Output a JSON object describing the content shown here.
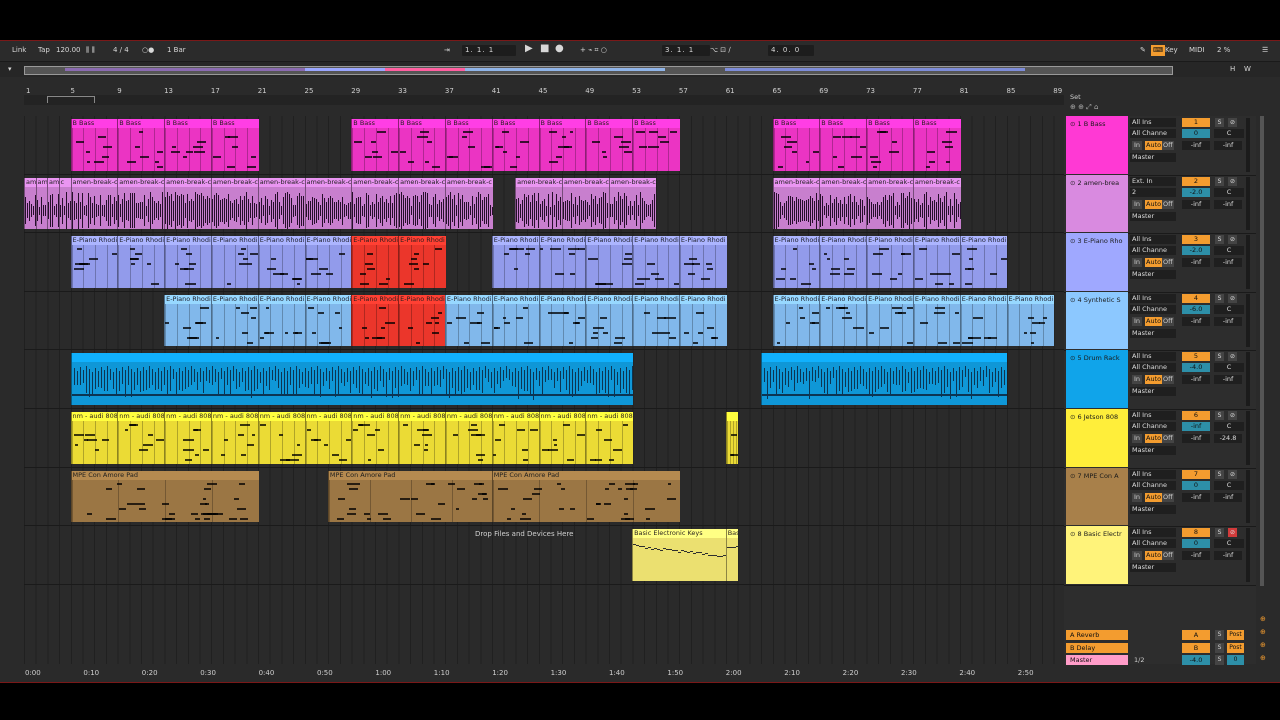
{
  "transport": {
    "link": "Link",
    "tap": "Tap",
    "tempo": "120.00",
    "signature": "4 / 4",
    "quantize": "1 Bar",
    "position": "1.  1.  1",
    "loop_start": "3.  1.  1",
    "loop_length": "4.  0.  0",
    "key": "Key",
    "midi": "MIDI",
    "cpu": "2 %"
  },
  "bar_numbers": [
    "1",
    "5",
    "9",
    "13",
    "17",
    "21",
    "25",
    "29",
    "33",
    "37",
    "41",
    "45",
    "49",
    "53",
    "57",
    "61",
    "65",
    "69",
    "73",
    "77",
    "81",
    "85",
    "89"
  ],
  "time_labels": [
    "0:00",
    "0:10",
    "0:20",
    "0:30",
    "0:40",
    "0:50",
    "1:00",
    "1:10",
    "1:20",
    "1:30",
    "1:40",
    "1:50",
    "2:00",
    "2:10",
    "2:20",
    "2:30",
    "2:40",
    "2:50"
  ],
  "drop_hint": "Drop Files and Devices Here",
  "set_label": "Set",
  "tracks": [
    {
      "name": "1 B Bass",
      "color": "#ff39d4",
      "input": "All Ins",
      "channel": "All Channe",
      "num": "1",
      "vol": "0",
      "pan": "C",
      "snd_a": "-inf",
      "snd_b": "-inf",
      "clips": [
        {
          "name": "B Bass",
          "start": 0,
          "bars": 4
        },
        {
          "name": "B Bass",
          "start": 4,
          "bars": 4
        },
        {
          "name": "B Bass",
          "start": 8,
          "bars": 4
        },
        {
          "name": "B Bass",
          "start": 12,
          "bars": 4
        },
        {
          "name": "B Bass",
          "start": 24,
          "bars": 4
        },
        {
          "name": "B Bass",
          "start": 28,
          "bars": 4
        },
        {
          "name": "B Bass",
          "start": 32,
          "bars": 4
        },
        {
          "name": "B Bass",
          "start": 36,
          "bars": 4
        },
        {
          "name": "B Bass",
          "start": 40,
          "bars": 4
        },
        {
          "name": "B Bass",
          "start": 44,
          "bars": 4
        },
        {
          "name": "B Bass",
          "start": 48,
          "bars": 4
        },
        {
          "name": "B Bass",
          "start": 60,
          "bars": 4
        },
        {
          "name": "B Bass",
          "start": 64,
          "bars": 4
        },
        {
          "name": "B Bass",
          "start": 68,
          "bars": 4
        },
        {
          "name": "B Bass",
          "start": 72,
          "bars": 4
        }
      ]
    },
    {
      "name": "2 amen-brea",
      "color": "#d98ae0",
      "input": "Ext. In",
      "channel": "2",
      "num": "2",
      "vol": "-2.0",
      "pan": "C",
      "snd_a": "-inf",
      "snd_b": "-inf",
      "clips": [
        {
          "name": "am",
          "start": -4,
          "bars": 1
        },
        {
          "name": "am",
          "start": -3,
          "bars": 1
        },
        {
          "name": "am",
          "start": -2,
          "bars": 1
        },
        {
          "name": "c",
          "start": -1,
          "bars": 1
        },
        {
          "name": "amen-break-c",
          "start": 0,
          "bars": 4
        },
        {
          "name": "amen-break-c",
          "start": 4,
          "bars": 4
        },
        {
          "name": "amen-break-c",
          "start": 8,
          "bars": 4
        },
        {
          "name": "amen-break-c",
          "start": 12,
          "bars": 4
        },
        {
          "name": "amen-break-c",
          "start": 16,
          "bars": 4
        },
        {
          "name": "amen-break-c",
          "start": 20,
          "bars": 4
        },
        {
          "name": "amen-break-c",
          "start": 24,
          "bars": 4
        },
        {
          "name": "amen-break-c",
          "start": 28,
          "bars": 4
        },
        {
          "name": "amen-break-c",
          "start": 32,
          "bars": 4
        },
        {
          "name": "amen-break-c",
          "start": 38,
          "bars": 4
        },
        {
          "name": "amen-break-c",
          "start": 42,
          "bars": 4
        },
        {
          "name": "amen-break-c",
          "start": 46,
          "bars": 4
        },
        {
          "name": "amen-break-c",
          "start": 60,
          "bars": 4
        },
        {
          "name": "amen-break-c",
          "start": 64,
          "bars": 4
        },
        {
          "name": "amen-break-c",
          "start": 68,
          "bars": 4
        },
        {
          "name": "amen-break-c",
          "start": 72,
          "bars": 4
        }
      ]
    },
    {
      "name": "3 E-Piano Rho",
      "color": "#9fa8ff",
      "input": "All Ins",
      "channel": "All Channe",
      "num": "3",
      "vol": "-2.0",
      "pan": "C",
      "snd_a": "-inf",
      "snd_b": "-inf",
      "clips": [
        {
          "name": "E-Piano Rhodi",
          "start": 0,
          "bars": 4
        },
        {
          "name": "E-Piano Rhodi",
          "start": 4,
          "bars": 4
        },
        {
          "name": "E-Piano Rhodi",
          "start": 8,
          "bars": 4
        },
        {
          "name": "E-Piano Rhodi",
          "start": 12,
          "bars": 4
        },
        {
          "name": "E-Piano Rhodi",
          "start": 16,
          "bars": 4
        },
        {
          "name": "E-Piano Rhodi",
          "start": 20,
          "bars": 4
        },
        {
          "name": "E-Piano Rhodi",
          "start": 24,
          "bars": 4,
          "color": "#ff3b2f"
        },
        {
          "name": "E-Piano Rhodi",
          "start": 28,
          "bars": 4,
          "color": "#ff3b2f"
        },
        {
          "name": "E-Piano Rhodi",
          "start": 36,
          "bars": 4
        },
        {
          "name": "E-Piano Rhodi",
          "start": 40,
          "bars": 4
        },
        {
          "name": "E-Piano Rhodi",
          "start": 44,
          "bars": 4
        },
        {
          "name": "E-Piano Rhodi",
          "start": 48,
          "bars": 4
        },
        {
          "name": "E-Piano Rhodi",
          "start": 52,
          "bars": 4
        },
        {
          "name": "E-Piano Rhodi",
          "start": 60,
          "bars": 4
        },
        {
          "name": "E-Piano Rhodi",
          "start": 64,
          "bars": 4
        },
        {
          "name": "E-Piano Rhodi",
          "start": 68,
          "bars": 4
        },
        {
          "name": "E-Piano Rhodi",
          "start": 72,
          "bars": 4
        },
        {
          "name": "E-Piano Rhodi",
          "start": 76,
          "bars": 4
        }
      ]
    },
    {
      "name": "4 Synthetic S",
      "color": "#8cc8ff",
      "input": "All Ins",
      "channel": "All Channe",
      "num": "4",
      "vol": "-6.0",
      "pan": "C",
      "snd_a": "-inf",
      "snd_b": "-inf",
      "clips": [
        {
          "name": "E-Piano Rhodi",
          "start": 8,
          "bars": 4
        },
        {
          "name": "E-Piano Rhodi",
          "start": 12,
          "bars": 4
        },
        {
          "name": "E-Piano Rhodi",
          "start": 16,
          "bars": 4
        },
        {
          "name": "E-Piano Rhodi",
          "start": 20,
          "bars": 4
        },
        {
          "name": "E-Piano Rhodi",
          "start": 24,
          "bars": 4,
          "color": "#ff3b2f"
        },
        {
          "name": "E-Piano Rhodi",
          "start": 28,
          "bars": 4,
          "color": "#ff3b2f"
        },
        {
          "name": "E-Piano Rhodi",
          "start": 32,
          "bars": 4
        },
        {
          "name": "E-Piano Rhodi",
          "start": 36,
          "bars": 4
        },
        {
          "name": "E-Piano Rhodi",
          "start": 40,
          "bars": 4
        },
        {
          "name": "E-Piano Rhodi",
          "start": 44,
          "bars": 4
        },
        {
          "name": "E-Piano Rhodi",
          "start": 48,
          "bars": 4
        },
        {
          "name": "E-Piano Rhodi",
          "start": 52,
          "bars": 4
        },
        {
          "name": "E-Piano Rhodi",
          "start": 60,
          "bars": 4
        },
        {
          "name": "E-Piano Rhodi",
          "start": 64,
          "bars": 4
        },
        {
          "name": "E-Piano Rhodi",
          "start": 68,
          "bars": 4
        },
        {
          "name": "E-Piano Rhodi",
          "start": 72,
          "bars": 4
        },
        {
          "name": "E-Piano Rhodi",
          "start": 76,
          "bars": 4
        },
        {
          "name": "E-Piano Rhodi",
          "start": 80,
          "bars": 4
        }
      ]
    },
    {
      "name": "5 Drum Rack",
      "color": "#10a4ea",
      "input": "All Ins",
      "channel": "All Channe",
      "num": "5",
      "vol": "-4.0",
      "pan": "C",
      "snd_a": "-inf",
      "snd_b": "-inf",
      "clips": [
        {
          "name": "",
          "start": 0,
          "bars": 48
        },
        {
          "name": "",
          "start": 59,
          "bars": 21
        }
      ]
    },
    {
      "name": "6 Jetson 808",
      "color": "#ffee3a",
      "input": "All Ins",
      "channel": "All Channe",
      "num": "6",
      "vol": "-inf",
      "pan": "C",
      "snd_a": "-inf",
      "snd_b": "-24.8",
      "clips": [
        {
          "name": "nm - audi 808",
          "start": 0,
          "bars": 4
        },
        {
          "name": "nm - audi 808",
          "start": 4,
          "bars": 4
        },
        {
          "name": "nm - audi 808",
          "start": 8,
          "bars": 4
        },
        {
          "name": "nm - audi 808",
          "start": 12,
          "bars": 4
        },
        {
          "name": "nm - audi 808",
          "start": 16,
          "bars": 4
        },
        {
          "name": "nm - audi 808",
          "start": 20,
          "bars": 4
        },
        {
          "name": "nm - audi 808",
          "start": 24,
          "bars": 4
        },
        {
          "name": "nm - audi 808",
          "start": 28,
          "bars": 4
        },
        {
          "name": "nm - audi 808",
          "start": 32,
          "bars": 4
        },
        {
          "name": "nm - audi 808",
          "start": 36,
          "bars": 4
        },
        {
          "name": "nm - audi 808",
          "start": 40,
          "bars": 4
        },
        {
          "name": "nm - audi 808",
          "start": 44,
          "bars": 4
        },
        {
          "name": "",
          "start": 56,
          "bars": 1
        }
      ]
    },
    {
      "name": "7 MPE Con A",
      "color": "#a8804a",
      "input": "All Ins",
      "channel": "All Channe",
      "num": "7",
      "vol": "0",
      "pan": "C",
      "snd_a": "-inf",
      "snd_b": "-inf",
      "clips": [
        {
          "name": "MPE Con Amore Pad",
          "start": 0,
          "bars": 16
        },
        {
          "name": "MPE Con Amore Pad",
          "start": 22,
          "bars": 14
        },
        {
          "name": "MPE Con Amore Pad",
          "start": 36,
          "bars": 16
        }
      ]
    },
    {
      "name": "8 Basic Electr",
      "color": "#fff37a",
      "input": "All Ins",
      "channel": "All Channe",
      "num": "8",
      "vol": "0",
      "pan": "C",
      "snd_a": "-inf",
      "snd_b": "-inf",
      "clips": [
        {
          "name": "Basic Electronic Keys",
          "start": 48,
          "bars": 8
        },
        {
          "name": "Bas",
          "start": 56,
          "bars": 1
        }
      ]
    }
  ],
  "returns": [
    {
      "name": "A Reverb",
      "letter": "A",
      "post": "Post",
      "color": "#f39c2f"
    },
    {
      "name": "B Delay",
      "letter": "B",
      "post": "Post",
      "color": "#f39c2f"
    },
    {
      "name": "Master",
      "letter": "-4.0",
      "post": "0",
      "color": "#ff9cc8",
      "cue": "1/2"
    }
  ],
  "routing": {
    "in": "In",
    "auto": "Auto",
    "off": "Off",
    "master": "Master"
  },
  "colors": {
    "accent": "#f39c2f",
    "volume": "#2d8fa8",
    "bg": "#2a2a2a"
  }
}
